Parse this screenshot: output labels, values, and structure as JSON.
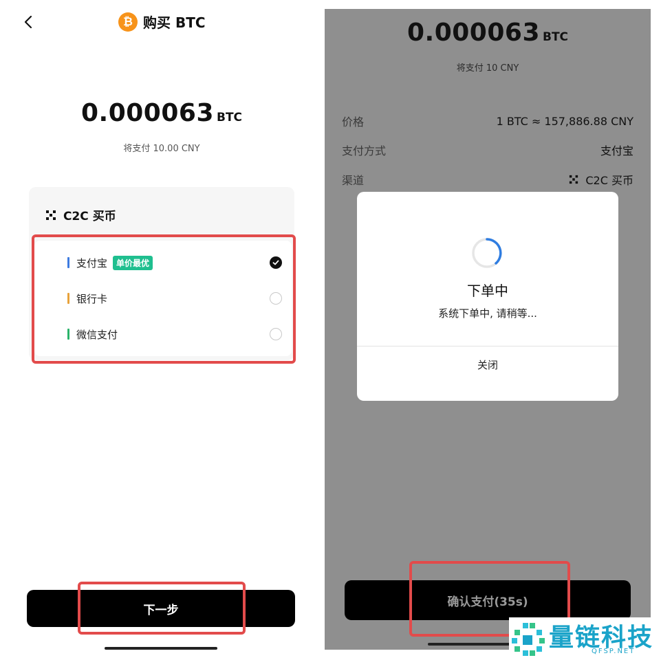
{
  "left": {
    "header": {
      "title": "购买 BTC",
      "coin_symbol": "₿"
    },
    "amount": {
      "value": "0.000063",
      "unit": "BTC"
    },
    "pay_text": "将支付 10.00 CNY",
    "card": {
      "title": "C2C 买币",
      "options": [
        {
          "label": "支付宝",
          "badge": "单价最优",
          "bar_color": "#3d7be0",
          "selected": true
        },
        {
          "label": "银行卡",
          "bar_color": "#e8a23a",
          "selected": false
        },
        {
          "label": "微信支付",
          "bar_color": "#2bb36a",
          "selected": false
        }
      ]
    },
    "next_button": "下一步"
  },
  "right": {
    "amount": {
      "value": "0.000063",
      "unit": "BTC"
    },
    "pay_text": "将支付 10 CNY",
    "rows": [
      {
        "key": "价格",
        "value": "1 BTC ≈ 157,886.88 CNY"
      },
      {
        "key": "支付方式",
        "value": "支付宝"
      },
      {
        "key": "渠道",
        "value": "C2C 买币"
      }
    ],
    "dialog": {
      "title": "下单中",
      "message": "系统下单中, 请稍等...",
      "close": "关闭"
    },
    "confirm_button": "确认支付(35s)"
  },
  "watermark": {
    "text": "量链科技",
    "sub": "QFSP.NET"
  },
  "colors": {
    "highlight": "#e24b4b",
    "btc": "#f7931a",
    "badge": "#1fbf8f",
    "spinner": "#2f7de1"
  }
}
